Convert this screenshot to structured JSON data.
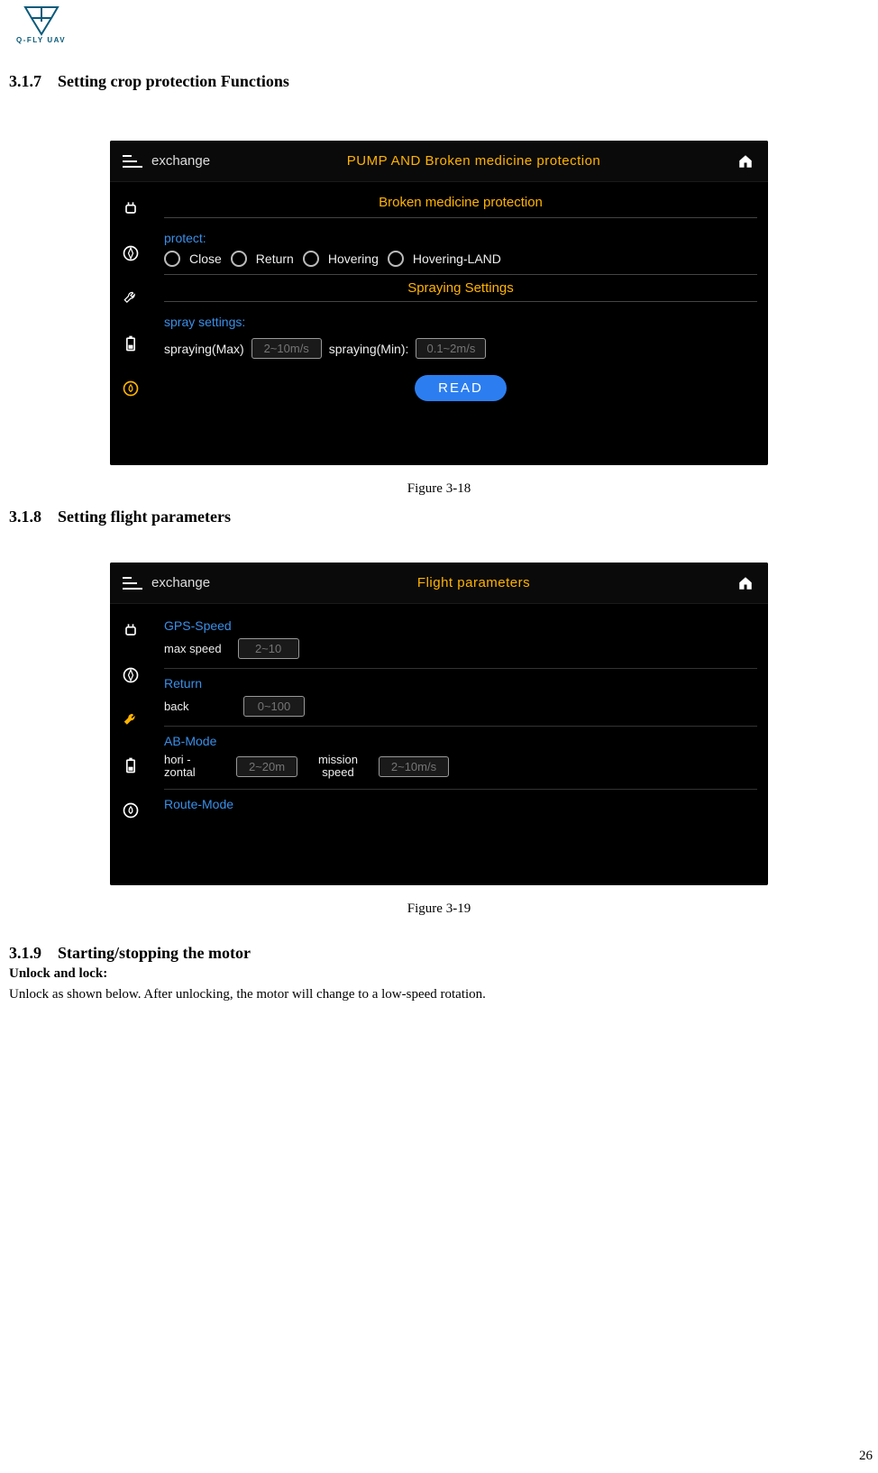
{
  "logo": {
    "text": "Q-FLY UAV"
  },
  "section_317": {
    "number": "3.1.7",
    "title": "Setting crop protection Functions"
  },
  "section_318": {
    "number": "3.1.8",
    "title": "Setting flight parameters"
  },
  "section_319": {
    "number": "3.1.9",
    "title": "Starting/stopping the motor"
  },
  "unlock_heading": "Unlock and lock:",
  "unlock_body": "Unlock as shown below. After unlocking, the motor will change to a low-speed rotation.",
  "fig318": "Figure 3-18",
  "fig319": "Figure 3-19",
  "page_number": "26",
  "panel1": {
    "exchange": "exchange",
    "title": "PUMP AND Broken medicine protection",
    "sub1": "Broken medicine protection",
    "protect_label": "protect:",
    "radios": {
      "close": "Close",
      "return": "Return",
      "hovering": "Hovering",
      "hovering_land": "Hovering-LAND"
    },
    "spraying_title": "Spraying Settings",
    "spray_settings_label": "spray settings:",
    "spraying_max_label": "spraying(Max)",
    "spraying_max_placeholder": "2~10m/s",
    "spraying_min_label": "spraying(Min):",
    "spraying_min_placeholder": "0.1~2m/s",
    "read": "READ"
  },
  "panel2": {
    "exchange": "exchange",
    "title": "Flight parameters",
    "gps_label": "GPS-Speed",
    "max_speed_label": "max speed",
    "max_speed_placeholder": "2~10",
    "return_label": "Return",
    "back_label": "back",
    "back_placeholder": "0~100",
    "ab_label": "AB-Mode",
    "hori_label_1": "hori -",
    "hori_label_2": "zontal",
    "hori_placeholder": "2~20m",
    "mission_label_1": "mission",
    "mission_label_2": "speed",
    "mission_placeholder": "2~10m/s",
    "route_label": "Route-Mode"
  }
}
